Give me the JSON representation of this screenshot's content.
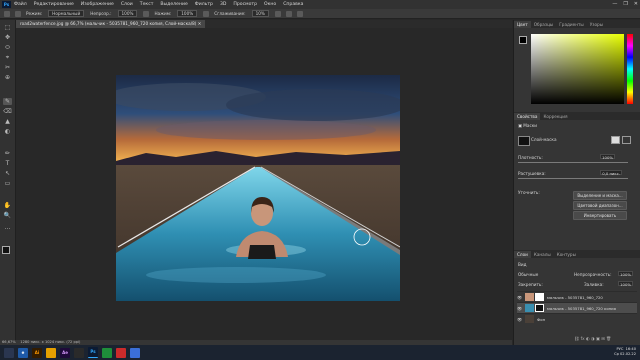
{
  "menu": {
    "logo": "Ps",
    "items": [
      "Файл",
      "Редактирование",
      "Изображение",
      "Слои",
      "Текст",
      "Выделение",
      "Фильтр",
      "3D",
      "Просмотр",
      "Окно",
      "Справка"
    ],
    "window_controls": [
      "—",
      "❐",
      "✕"
    ]
  },
  "options": {
    "mode_label": "Режим:",
    "mode_value": "Нормальный",
    "opacity_label": "Непрозр.:",
    "opacity_value": "100%",
    "flow_label": "Нажим:",
    "flow_value": "100%",
    "smoothing_label": "Сглаживание:",
    "smoothing_value": "10%"
  },
  "document": {
    "tab_title": "road2waterfence.jpg @ 66,7% (мальчик - 5035781_960_720 копия, Слой-маска/8) ✕",
    "zoom": "66,67%",
    "size_info": "1280 пикс. x 1024 пикс. (72 ppi)"
  },
  "tools": [
    "⬚",
    "✥",
    "⬭",
    "⌖",
    "✂",
    "⊕",
    "✎",
    "⌫",
    "▲",
    "◐",
    "✏",
    "T",
    "↖",
    "▭",
    "✋",
    "🔍",
    "…"
  ],
  "colors": {
    "accent": "#31a8ff",
    "panel": "#353535",
    "workspace": "#282828",
    "selected": "#4d4d4d"
  },
  "color_panel": {
    "tabs": [
      "Цвет",
      "Образцы",
      "Градиенты",
      "Узоры"
    ]
  },
  "properties": {
    "tabs": [
      "Свойства",
      "Коррекция"
    ],
    "mask_label": "Маски",
    "layer_mask_label": "Слой-маска",
    "density_label": "Плотность:",
    "density_value": "100%",
    "feather_label": "Растушевка:",
    "feather_value": "0,0 пикс.",
    "refine_label": "Уточнить:",
    "buttons": [
      "Выделение и маска...",
      "Цветовой диапазон...",
      "Инвертировать"
    ]
  },
  "layers": {
    "tabs": [
      "Слои",
      "Каналы",
      "Контуры"
    ],
    "filter_label": "Вид",
    "blend_mode": "Обычные",
    "opacity_label": "Непрозрачность:",
    "opacity_value": "100%",
    "lock_label": "Закрепить:",
    "fill_label": "Заливка:",
    "fill_value": "100%",
    "rows": [
      {
        "name": "мальчик - 5035781_960_720"
      },
      {
        "name": "мальчик - 5035781_960_720 копия"
      },
      {
        "name": "Фон"
      }
    ],
    "footer_icons": "⛓ fx ◐ ◑ ▣ ⊞ 🗑"
  },
  "taskbar": {
    "apps": [
      "",
      "e",
      "Ai",
      "",
      "Ae",
      "",
      "Ps",
      "",
      "",
      ""
    ],
    "time": "16:40",
    "date": "Ср 02.02.22",
    "lang": "РУС"
  }
}
